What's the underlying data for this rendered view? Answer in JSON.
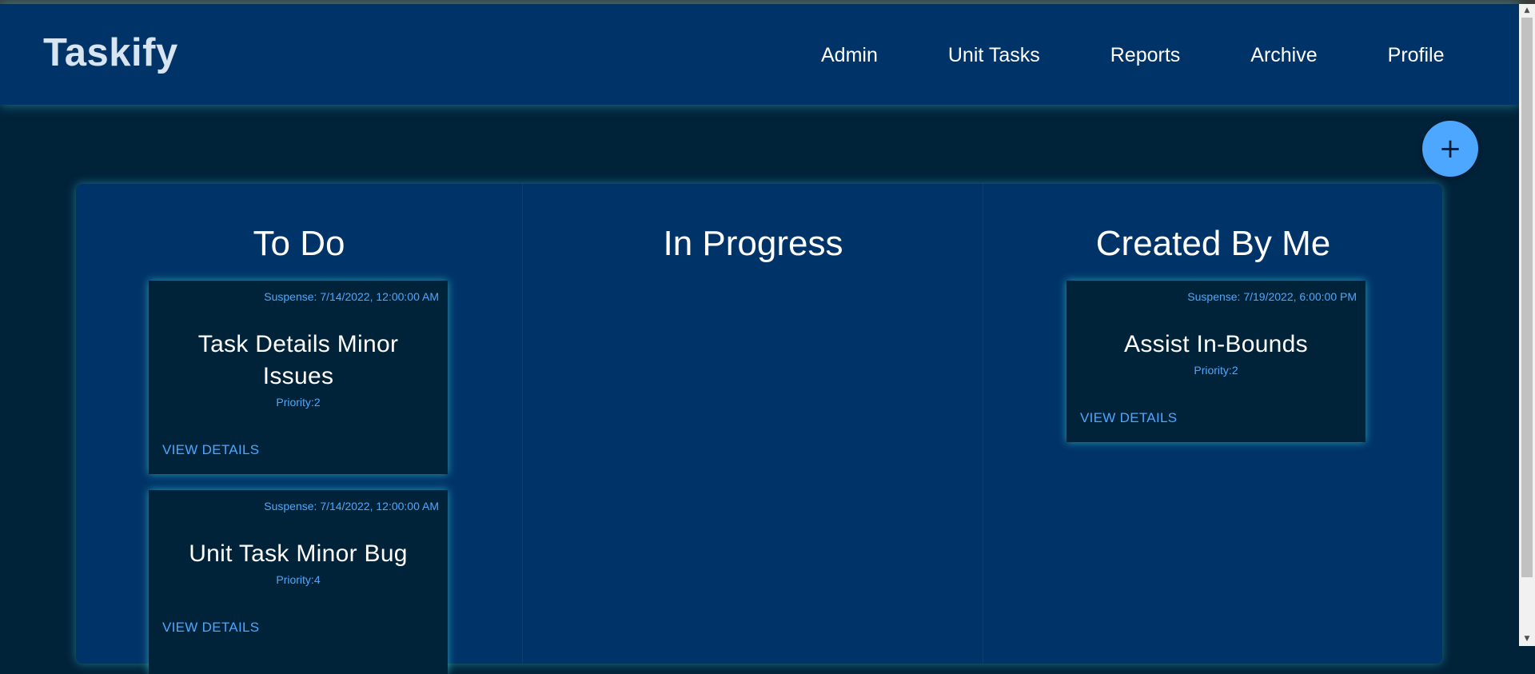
{
  "app": {
    "brand": "Taskify"
  },
  "nav": {
    "items": [
      {
        "label": "Admin"
      },
      {
        "label": "Unit Tasks"
      },
      {
        "label": "Reports"
      },
      {
        "label": "Archive"
      },
      {
        "label": "Profile"
      }
    ]
  },
  "fab": {
    "label": "+",
    "icon": "plus-icon"
  },
  "columns": {
    "todo": {
      "title": "To Do",
      "cards": [
        {
          "suspense": "Suspense: 7/14/2022, 12:00:00 AM",
          "title_line1": "Task Details Minor",
          "title_line2": "Issues",
          "priority": "Priority:2",
          "action": "VIEW DETAILS"
        },
        {
          "suspense": "Suspense: 7/14/2022, 12:00:00 AM",
          "title": "Unit Task Minor Bug",
          "priority": "Priority:4",
          "action": "VIEW DETAILS"
        }
      ]
    },
    "in_progress": {
      "title": "In Progress",
      "cards": []
    },
    "created_by_me": {
      "title": "Created By Me",
      "cards": [
        {
          "suspense": "Suspense: 7/19/2022, 6:00:00 PM",
          "title": "Assist In-Bounds",
          "priority": "Priority:2",
          "action": "VIEW DETAILS"
        }
      ]
    }
  },
  "colors": {
    "navbar": "#003468",
    "background": "#00233a",
    "board": "#003468",
    "accent": "#4da7ff",
    "glow": "#40c8dc"
  }
}
